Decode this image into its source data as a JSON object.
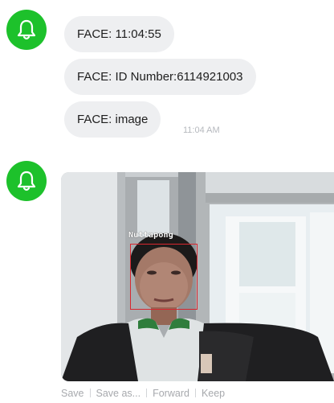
{
  "messages": [
    {
      "text": "FACE: 11:04:55"
    },
    {
      "text": "FACE: ID Number:6114921003"
    },
    {
      "text": "FACE: image"
    }
  ],
  "timestamp": "11:04 AM",
  "image_message": {
    "face_label": "Nuttapong",
    "face_box_color": "#d8262e"
  },
  "actions": {
    "save": "Save",
    "save_as": "Save as...",
    "forward": "Forward",
    "keep": "Keep"
  },
  "colors": {
    "avatar_green": "#1dc12b",
    "bubble_bg": "#eeeff1",
    "muted_text": "#a7a9ad"
  },
  "icons": {
    "avatar": "bell-icon"
  }
}
